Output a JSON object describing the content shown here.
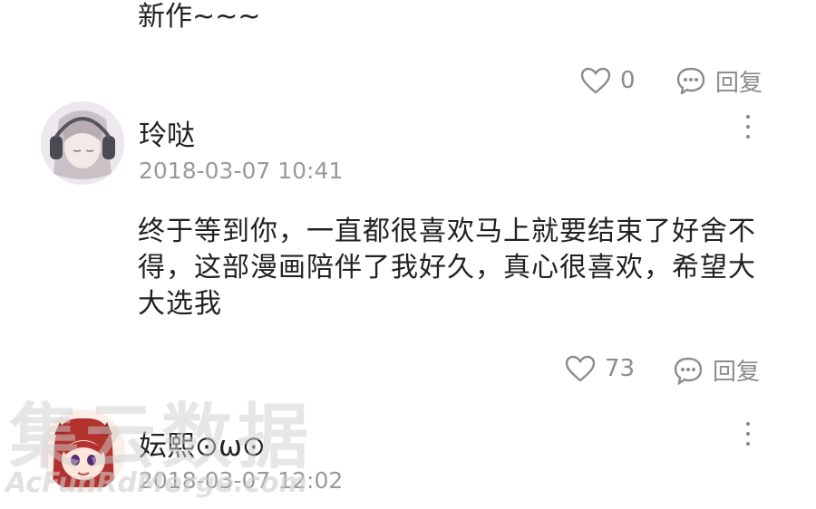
{
  "prev_comment": {
    "text_tail": "新作~~~",
    "like_count": "0",
    "reply_label": "回复"
  },
  "comment1": {
    "username": "玲哒",
    "timestamp": "2018-03-07 10:41",
    "body": "终于等到你，一直都很喜欢马上就要结束了好舍不得，这部漫画陪伴了我好久，真心很喜欢，希望大大选我",
    "like_count": "73",
    "reply_label": "回复"
  },
  "comment2": {
    "username": "妘熙⊙ω⊙",
    "timestamp": "2018-03-07 12:02"
  },
  "watermark": {
    "cn": "集云数据",
    "en": "AcFunRdMerge.com"
  },
  "colors": {
    "text": "#222222",
    "meta": "#9a9a9a",
    "icon": "#8c8c8c"
  },
  "icons": [
    "heart-icon",
    "comment-bubble-icon",
    "more-vertical-icon"
  ]
}
